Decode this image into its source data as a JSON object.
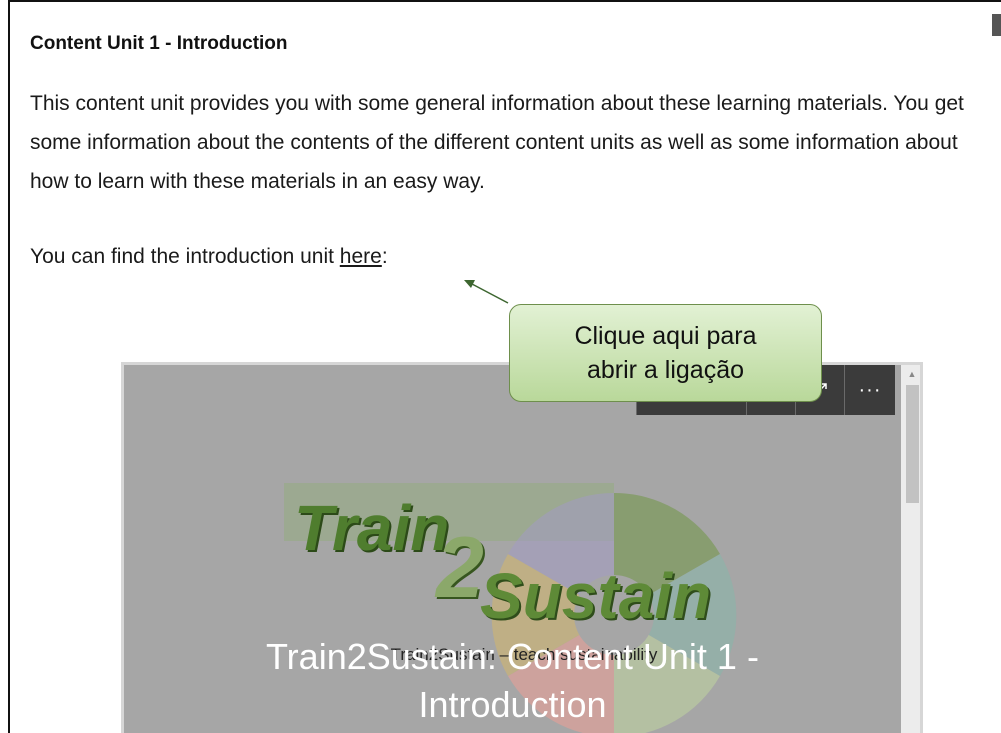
{
  "unit": {
    "heading": "Content Unit 1 - Introduction",
    "intro": "This content unit provides you with some general information about these learning materials. You get some information about the contents of the different content units as well as some information about how to learn with these materials in an easy way.",
    "find_prefix": "You can find the introduction unit ",
    "find_link": "here",
    "find_suffix": ":"
  },
  "callout": {
    "line1": "Clique aqui para",
    "line2": "abrir a ligação"
  },
  "embed": {
    "toolbar_more": "···",
    "logo": {
      "train": "Train",
      "two": "2",
      "sustain": "Sustain",
      "under_text": "Train2Sustain – teach sustainability"
    },
    "title_line1": "Train2Sustain: Content Unit 1 -",
    "title_line2": "Introduction",
    "wheel_colors": [
      "#7d9a5e",
      "#8fb2a8",
      "#b8c8a0",
      "#d9a09a",
      "#c7b27a",
      "#a39ac2"
    ]
  }
}
